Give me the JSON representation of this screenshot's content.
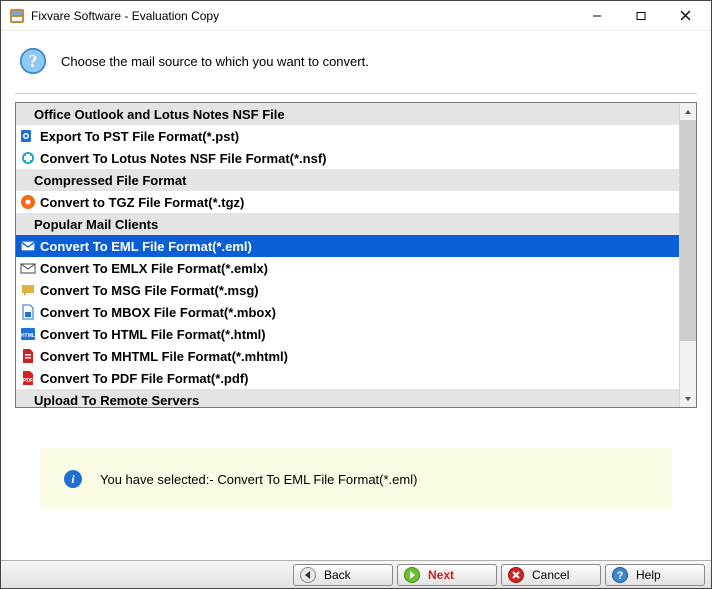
{
  "titlebar": {
    "title": "Fixvare Software - Evaluation Copy"
  },
  "instruction": "Choose the mail source to which you want to convert.",
  "groups": [
    {
      "header": "Office Outlook and Lotus Notes NSF File",
      "items": [
        {
          "id": "pst",
          "label": "Export To PST File Format(*.pst)",
          "iconColor": "#1e6fd6",
          "iconType": "outlook"
        },
        {
          "id": "nsf",
          "label": "Convert To Lotus Notes NSF File Format(*.nsf)",
          "iconColor": "#1aa6c9",
          "iconType": "lotus"
        }
      ]
    },
    {
      "header": "Compressed File Format",
      "items": [
        {
          "id": "tgz",
          "label": "Convert to TGZ File Format(*.tgz)",
          "iconColor": "#f26a1b",
          "iconType": "disc"
        }
      ]
    },
    {
      "header": "Popular Mail Clients",
      "items": [
        {
          "id": "eml",
          "label": "Convert To EML File Format(*.eml)",
          "iconColor": "#1e6fd6",
          "iconType": "mail",
          "selected": true
        },
        {
          "id": "emlx",
          "label": "Convert To EMLX File Format(*.emlx)",
          "iconColor": "#444",
          "iconType": "envelope"
        },
        {
          "id": "msg",
          "label": "Convert To MSG File Format(*.msg)",
          "iconColor": "#e0b040",
          "iconType": "bubble"
        },
        {
          "id": "mbox",
          "label": "Convert To MBOX File Format(*.mbox)",
          "iconColor": "#1e6fd6",
          "iconType": "file"
        },
        {
          "id": "html",
          "label": "Convert To HTML File Format(*.html)",
          "iconColor": "#1e6fd6",
          "iconType": "html"
        },
        {
          "id": "mhtml",
          "label": "Convert To MHTML File Format(*.mhtml)",
          "iconColor": "#c22",
          "iconType": "file2"
        },
        {
          "id": "pdf",
          "label": "Convert To PDF File Format(*.pdf)",
          "iconColor": "#d32424",
          "iconType": "pdf"
        }
      ]
    },
    {
      "header": "Upload To Remote Servers",
      "items": []
    }
  ],
  "info": {
    "prefix": "You have selected:- ",
    "value": "Convert To EML File Format(*.eml)"
  },
  "buttons": {
    "back": "Back",
    "next": "Next",
    "cancel": "Cancel",
    "help": "Help"
  }
}
